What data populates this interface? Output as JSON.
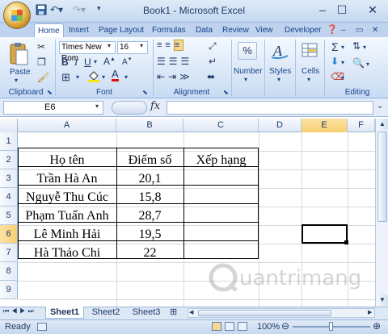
{
  "window": {
    "title": "Book1 - Microsoft Excel"
  },
  "tabs": [
    "Home",
    "Insert",
    "Page Layout",
    "Formulas",
    "Data",
    "Review",
    "View",
    "Developer"
  ],
  "ribbon": {
    "paste_label": "Paste",
    "font_name": "Times New Rom",
    "font_size": "16",
    "number_label": "Number",
    "number_symbol": "%",
    "styles_label": "Styles",
    "cells_label": "Cells",
    "groups": [
      "Clipboard",
      "Font",
      "Alignment",
      "Editing"
    ]
  },
  "formula_bar": {
    "name_box": "E6",
    "fx": "fx",
    "formula": ""
  },
  "columns": [
    "A",
    "B",
    "C",
    "D",
    "E",
    "F"
  ],
  "rows": [
    "1",
    "2",
    "3",
    "4",
    "5",
    "6",
    "7",
    "8",
    "9"
  ],
  "table": {
    "headers": [
      "Họ tên",
      "Điểm số",
      "Xếp hạng"
    ],
    "rows": [
      {
        "name": "Trần Hà An",
        "score": "20,1",
        "rank": ""
      },
      {
        "name": "Nguyễ Thu Cúc",
        "score": "15,8",
        "rank": ""
      },
      {
        "name": "Phạm Tuấn Anh",
        "score": "28,7",
        "rank": ""
      },
      {
        "name": "Lê Minh Hải",
        "score": "19,5",
        "rank": ""
      },
      {
        "name": "Hà Thảo Chi",
        "score": "22",
        "rank": ""
      }
    ]
  },
  "sheets": [
    "Sheet1",
    "Sheet2",
    "Sheet3"
  ],
  "status": {
    "ready": "Ready",
    "zoom": "100%"
  },
  "watermark": "uantrimang",
  "colors": {
    "ribbon_blue": "#15428b",
    "selected_header": "#f8d891"
  }
}
